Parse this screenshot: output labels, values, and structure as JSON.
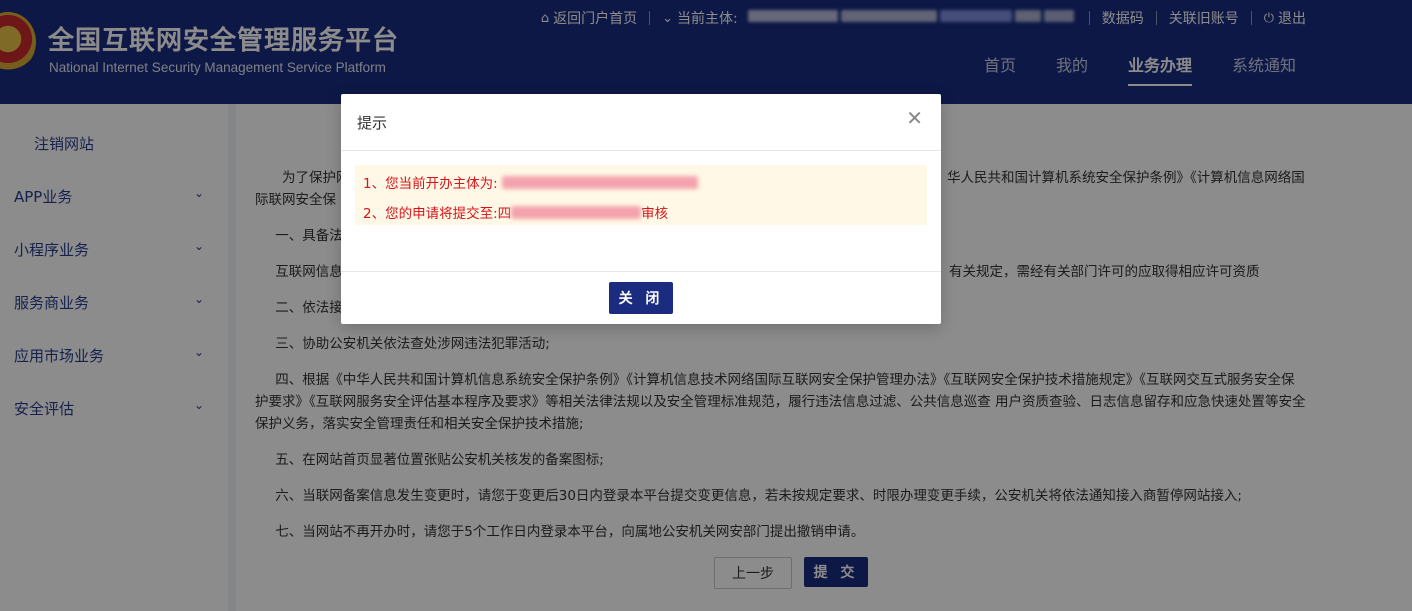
{
  "header": {
    "title": "全国互联网安全管理服务平台",
    "subtitle": "National Internet Security Management Service Platform",
    "topbar": {
      "home_link": "返回门户首页",
      "entity_label": "当前主体:",
      "data_code": "数据码",
      "link_old_account": "关联旧账号",
      "logout": "退出"
    },
    "nav": [
      "首页",
      "我的",
      "业务办理",
      "系统通知"
    ],
    "active_nav": "业务办理",
    "icons": {
      "home": "home-icon",
      "dropdown": "chevron-down-icon",
      "logout": "power-icon"
    }
  },
  "sidebar": {
    "sub_item": "注销网站",
    "items": [
      "APP业务",
      "小程序业务",
      "服务商业务",
      "应用市场业务",
      "安全评估"
    ]
  },
  "content": {
    "para_intro_a": "为了保护网",
    "para_intro_b": "华人民共和国计算机系统安全保护条例》《计算机信息网络国",
    "para_intro_c": "际联网安全保",
    "para_1": "一、具备法",
    "para_licence_a": "互联网信息",
    "para_licence_b": "有关规定，需经有关部门许可的应取得相应许可资质",
    "para_2": "二、依法接",
    "para_3": "三、协助公安机关依法查处涉网违法犯罪活动;",
    "para_4": "四、根据《中华人民共和国计算机信息系统安全保护条例》《计算机信息技术网络国际互联网安全保护管理办法》《互联网安全保护技术措施规定》《互联网交互式服务安全保护要求》《互联网服务安全评估基本程序及要求》等相关法律法规以及安全管理标准规范，履行违法信息过滤、公共信息巡查 用户资质查验、日志信息留存和应急快速处置等安全保护义务，落实安全管理责任和相关安全保护技术措施;",
    "para_5": "五、在网站首页显著位置张贴公安机关核发的备案图标;",
    "para_6": "六、当联网备案信息发生变更时，请您于变更后30日内登录本平台提交变更信息，若未按规定要求、时限办理变更手续，公安机关将依法通知接入商暂停网站接入;",
    "para_7": "七、当网站不再开办时，请您于5个工作日内登录本平台，向属地公安机关网安部门提出撤销申请。",
    "btn_prev": "上一步",
    "btn_submit": "提 交"
  },
  "dialog": {
    "title": "提示",
    "line1_prefix": "1、您当前开办主体为:",
    "line2_prefix": "2、您的申请将提交至:",
    "line2_lead": "四",
    "line2_suffix": "审核",
    "close_button": "关 闭",
    "close_icon": "close-icon"
  },
  "colors": {
    "brand": "#1b2c80",
    "warning_text": "#d8141a",
    "warning_bg": "#fff8e6"
  }
}
